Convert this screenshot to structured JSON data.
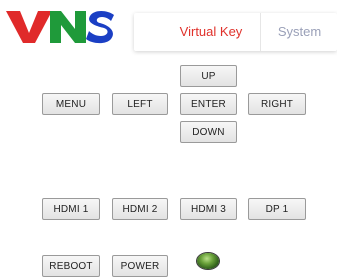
{
  "header": {
    "logo_text": "VNS",
    "tabs": [
      {
        "label": "Virtual Key",
        "active": true,
        "color": "#e0312b"
      },
      {
        "label": "System",
        "active": false,
        "color": "#9aa0b8"
      }
    ]
  },
  "keypad": {
    "up": "UP",
    "menu": "MENU",
    "left": "LEFT",
    "enter": "ENTER",
    "right": "RIGHT",
    "down": "DOWN"
  },
  "sources": {
    "hdmi1": "HDMI 1",
    "hdmi2": "HDMI 2",
    "hdmi3": "HDMI 3",
    "dp1": "DP 1"
  },
  "power": {
    "reboot": "REBOOT",
    "power": "POWER",
    "status_led_color": "#4f8a2a"
  }
}
